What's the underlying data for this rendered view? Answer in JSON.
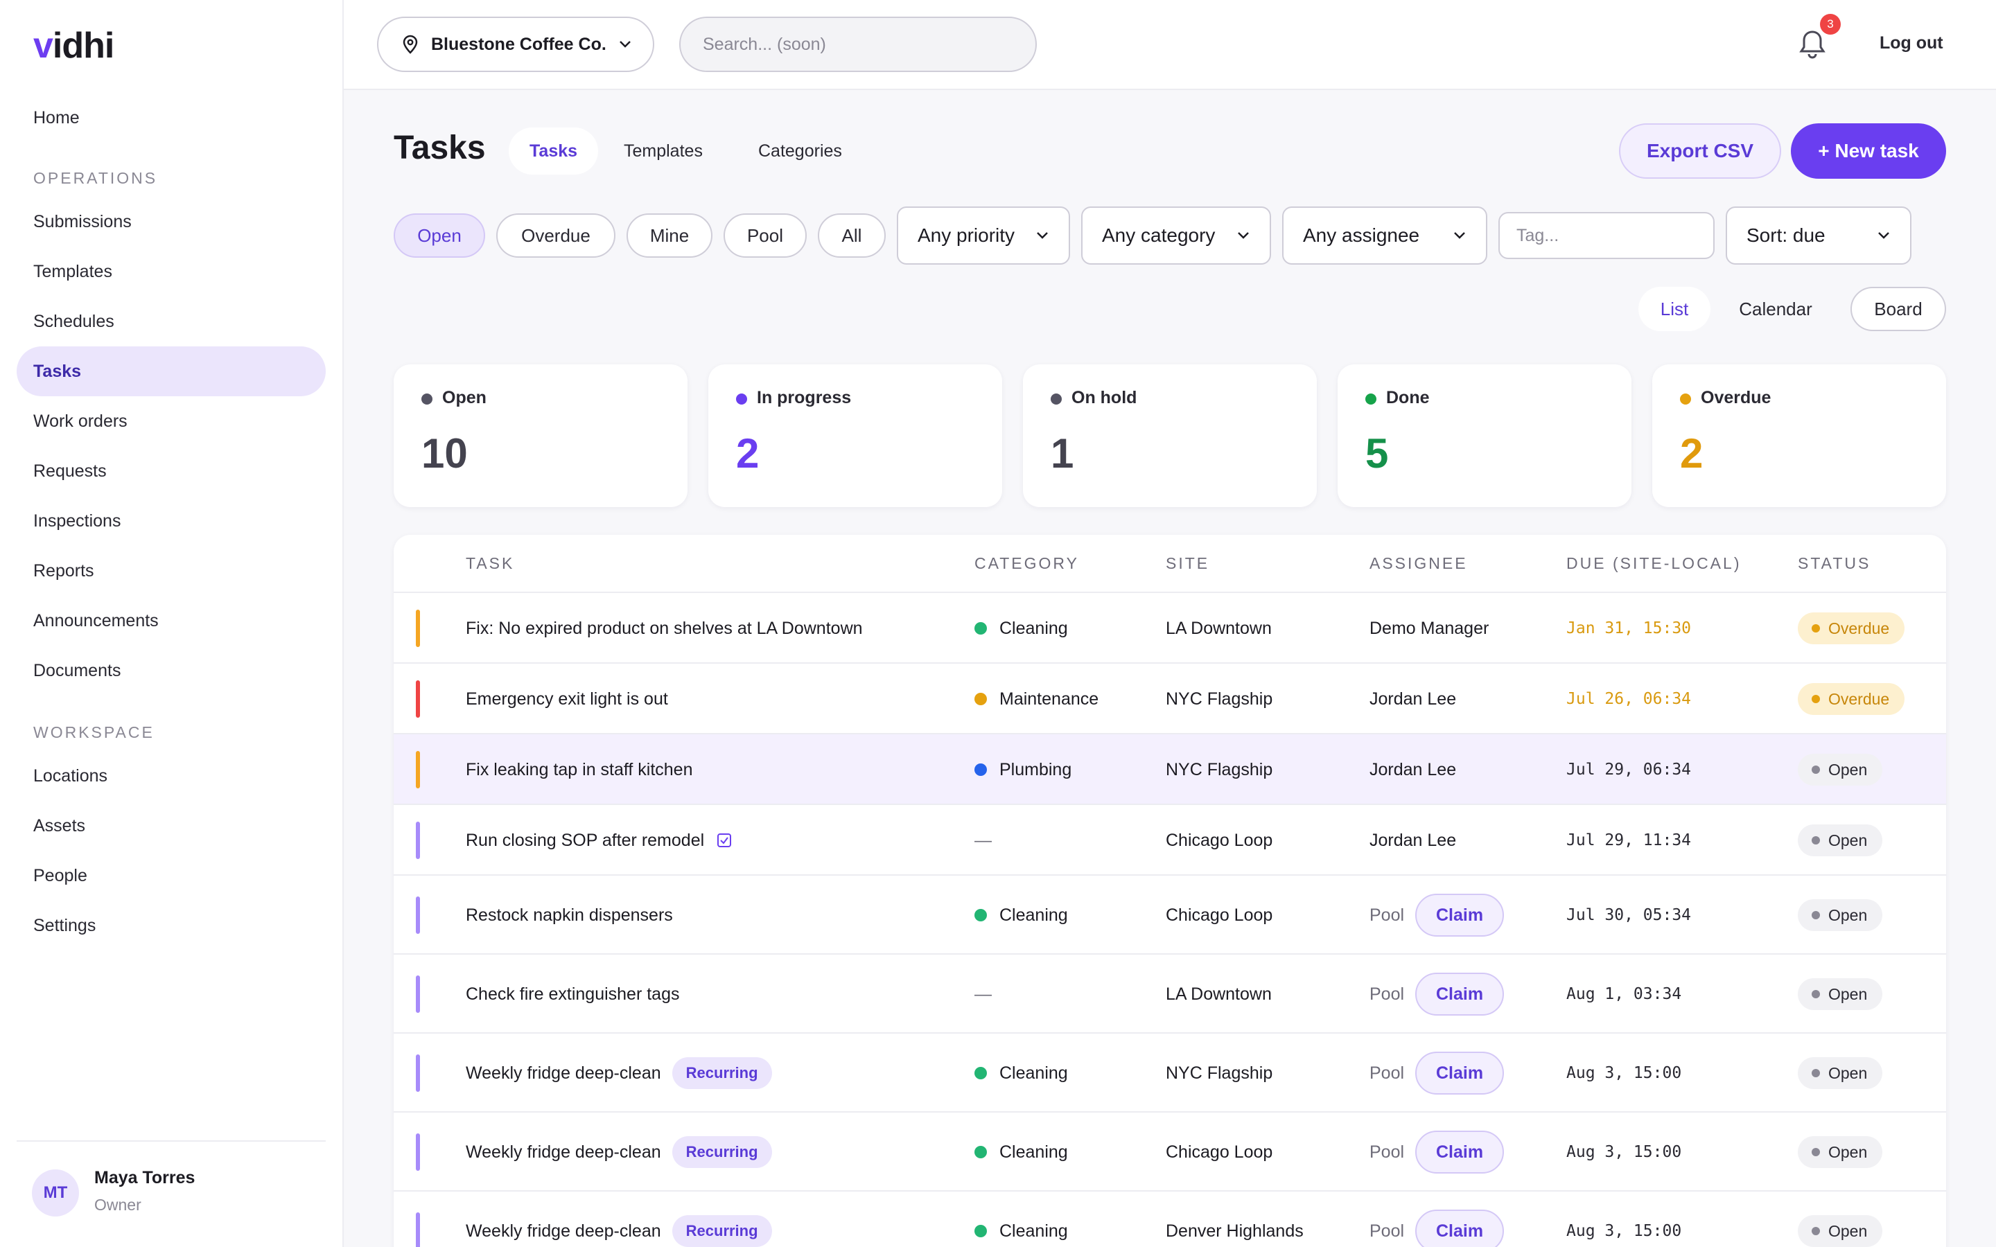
{
  "app": {
    "logo_v": "v",
    "logo_rest": "idhi"
  },
  "sidebar": {
    "home": "Home",
    "operations_label": "OPERATIONS",
    "operations": [
      "Submissions",
      "Templates",
      "Schedules",
      "Tasks",
      "Work orders",
      "Requests",
      "Inspections",
      "Reports",
      "Announcements",
      "Documents"
    ],
    "active": "Tasks",
    "workspace_label": "WORKSPACE",
    "workspace": [
      "Locations",
      "Assets",
      "People",
      "Settings"
    ],
    "user": {
      "initials": "MT",
      "name": "Maya Torres",
      "role": "Owner"
    }
  },
  "topbar": {
    "org": "Bluestone Coffee Co.",
    "search_placeholder": "Search... (soon)",
    "notifications": "3",
    "logout": "Log out"
  },
  "header": {
    "title": "Tasks",
    "tabs": [
      "Tasks",
      "Templates",
      "Categories"
    ],
    "active_tab": "Tasks",
    "export": "Export CSV",
    "new_task": "+ New task"
  },
  "filters": {
    "chips": [
      "Open",
      "Overdue",
      "Mine",
      "Pool",
      "All"
    ],
    "active_chip": "Open",
    "priority": "Any priority",
    "category": "Any category",
    "assignee": "Any assignee",
    "tag_placeholder": "Tag...",
    "sort": "Sort: due"
  },
  "views": {
    "list": "List",
    "calendar": "Calendar",
    "board": "Board",
    "active": "List"
  },
  "stats": [
    {
      "label": "Open",
      "value": "10",
      "dot": "#555463",
      "color": "#44434f"
    },
    {
      "label": "In progress",
      "value": "2",
      "dot": "#6a3ef0",
      "color": "#6a3ef0"
    },
    {
      "label": "On hold",
      "value": "1",
      "dot": "#555463",
      "color": "#44434f"
    },
    {
      "label": "Done",
      "value": "5",
      "dot": "#16a34a",
      "color": "#15904a"
    },
    {
      "label": "Overdue",
      "value": "2",
      "dot": "#e5a10f",
      "color": "#e09a0c"
    }
  ],
  "table": {
    "columns": [
      "TASK",
      "CATEGORY",
      "SITE",
      "ASSIGNEE",
      "DUE (SITE-LOCAL)",
      "STATUS"
    ],
    "pool_label": "Pool",
    "claim_label": "Claim",
    "recurring_label": "Recurring",
    "rows": [
      {
        "task": "Fix: No expired product on shelves at LA Downtown",
        "category": "Cleaning",
        "cat_color": "#22b573",
        "site": "LA Downtown",
        "assignee": "Demo Manager",
        "due": "Jan 31, 15:30",
        "status": "Overdue",
        "priority_color": "#f5a623"
      },
      {
        "task": "Emergency exit light is out",
        "category": "Maintenance",
        "cat_color": "#e5a10f",
        "site": "NYC Flagship",
        "assignee": "Jordan Lee",
        "due": "Jul 26, 06:34",
        "status": "Overdue",
        "priority_color": "#ef4444"
      },
      {
        "task": "Fix leaking tap in staff kitchen",
        "category": "Plumbing",
        "cat_color": "#2563eb",
        "site": "NYC Flagship",
        "assignee": "Jordan Lee",
        "due": "Jul 29, 06:34",
        "status": "Open",
        "priority_color": "#f5a623"
      },
      {
        "task": "Run closing SOP after remodel",
        "category": "—",
        "cat_color": "",
        "site": "Chicago Loop",
        "assignee": "Jordan Lee",
        "due": "Jul 29, 11:34",
        "status": "Open",
        "priority_color": "#a78bfa"
      },
      {
        "task": "Restock napkin dispensers",
        "category": "Cleaning",
        "cat_color": "#22b573",
        "site": "Chicago Loop",
        "assignee": "Pool",
        "due": "Jul 30, 05:34",
        "status": "Open",
        "priority_color": "#a78bfa"
      },
      {
        "task": "Check fire extinguisher tags",
        "category": "—",
        "cat_color": "",
        "site": "LA Downtown",
        "assignee": "Pool",
        "due": "Aug 1, 03:34",
        "status": "Open",
        "priority_color": "#a78bfa"
      },
      {
        "task": "Weekly fridge deep-clean",
        "category": "Cleaning",
        "cat_color": "#22b573",
        "site": "NYC Flagship",
        "assignee": "Pool",
        "due": "Aug 3, 15:00",
        "status": "Open",
        "priority_color": "#a78bfa"
      },
      {
        "task": "Weekly fridge deep-clean",
        "category": "Cleaning",
        "cat_color": "#22b573",
        "site": "Chicago Loop",
        "assignee": "Pool",
        "due": "Aug 3, 15:00",
        "status": "Open",
        "priority_color": "#a78bfa"
      },
      {
        "task": "Weekly fridge deep-clean",
        "category": "Cleaning",
        "cat_color": "#22b573",
        "site": "Denver Highlands",
        "assignee": "Pool",
        "due": "Aug 3, 15:00",
        "status": "Open",
        "priority_color": "#a78bfa"
      }
    ]
  }
}
